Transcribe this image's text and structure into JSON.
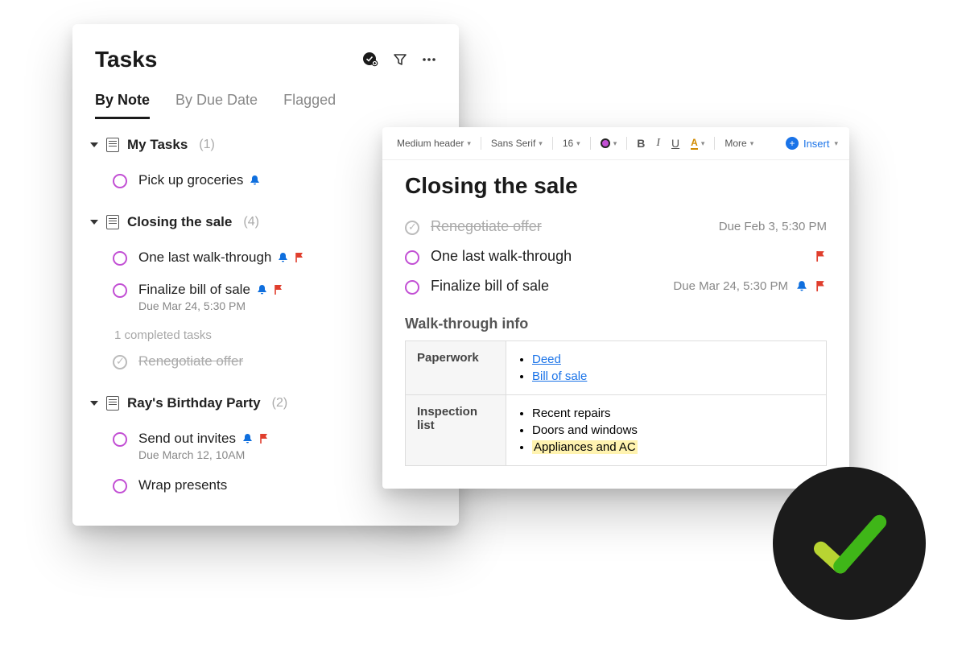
{
  "tasksPanel": {
    "title": "Tasks",
    "tabs": [
      "By Note",
      "By Due Date",
      "Flagged"
    ],
    "activeTab": 0,
    "sections": [
      {
        "title": "My Tasks",
        "count": "(1)",
        "tasks": [
          {
            "title": "Pick up groceries",
            "bell": true,
            "flag": false
          }
        ]
      },
      {
        "title": "Closing the sale",
        "count": "(4)",
        "tasks": [
          {
            "title": "One last walk-through",
            "bell": true,
            "flag": true
          },
          {
            "title": "Finalize bill of sale",
            "due": "Due Mar 24, 5:30 PM",
            "bell": true,
            "flag": true
          }
        ],
        "completedLabel": "1 completed tasks",
        "completedTasks": [
          {
            "title": "Renegotiate offer"
          }
        ]
      },
      {
        "title": "Ray's Birthday Party",
        "count": "(2)",
        "tasks": [
          {
            "title": "Send out invites",
            "due": "Due March 12, 10AM",
            "bell": true,
            "flag": true
          },
          {
            "title": "Wrap presents"
          }
        ]
      }
    ]
  },
  "editor": {
    "toolbar": {
      "headerStyle": "Medium header",
      "font": "Sans Serif",
      "size": "16",
      "more": "More",
      "insert": "Insert"
    },
    "title": "Closing the sale",
    "tasks": [
      {
        "title": "Renegotiate offer",
        "done": true,
        "due": "Due Feb 3, 5:30 PM"
      },
      {
        "title": "One last walk-through",
        "flag": true
      },
      {
        "title": "Finalize bill of sale",
        "due": "Due Mar 24, 5:30 PM",
        "bell": true,
        "flag": true
      }
    ],
    "infoHeading": "Walk-through info",
    "table": [
      {
        "label": "Paperwork",
        "items": [
          {
            "text": "Deed",
            "link": true
          },
          {
            "text": "Bill of sale",
            "link": true
          }
        ]
      },
      {
        "label": "Inspection list",
        "items": [
          {
            "text": "Recent repairs"
          },
          {
            "text": "Doors and windows"
          },
          {
            "text": "Appliances and AC",
            "highlight": true
          }
        ]
      }
    ]
  }
}
